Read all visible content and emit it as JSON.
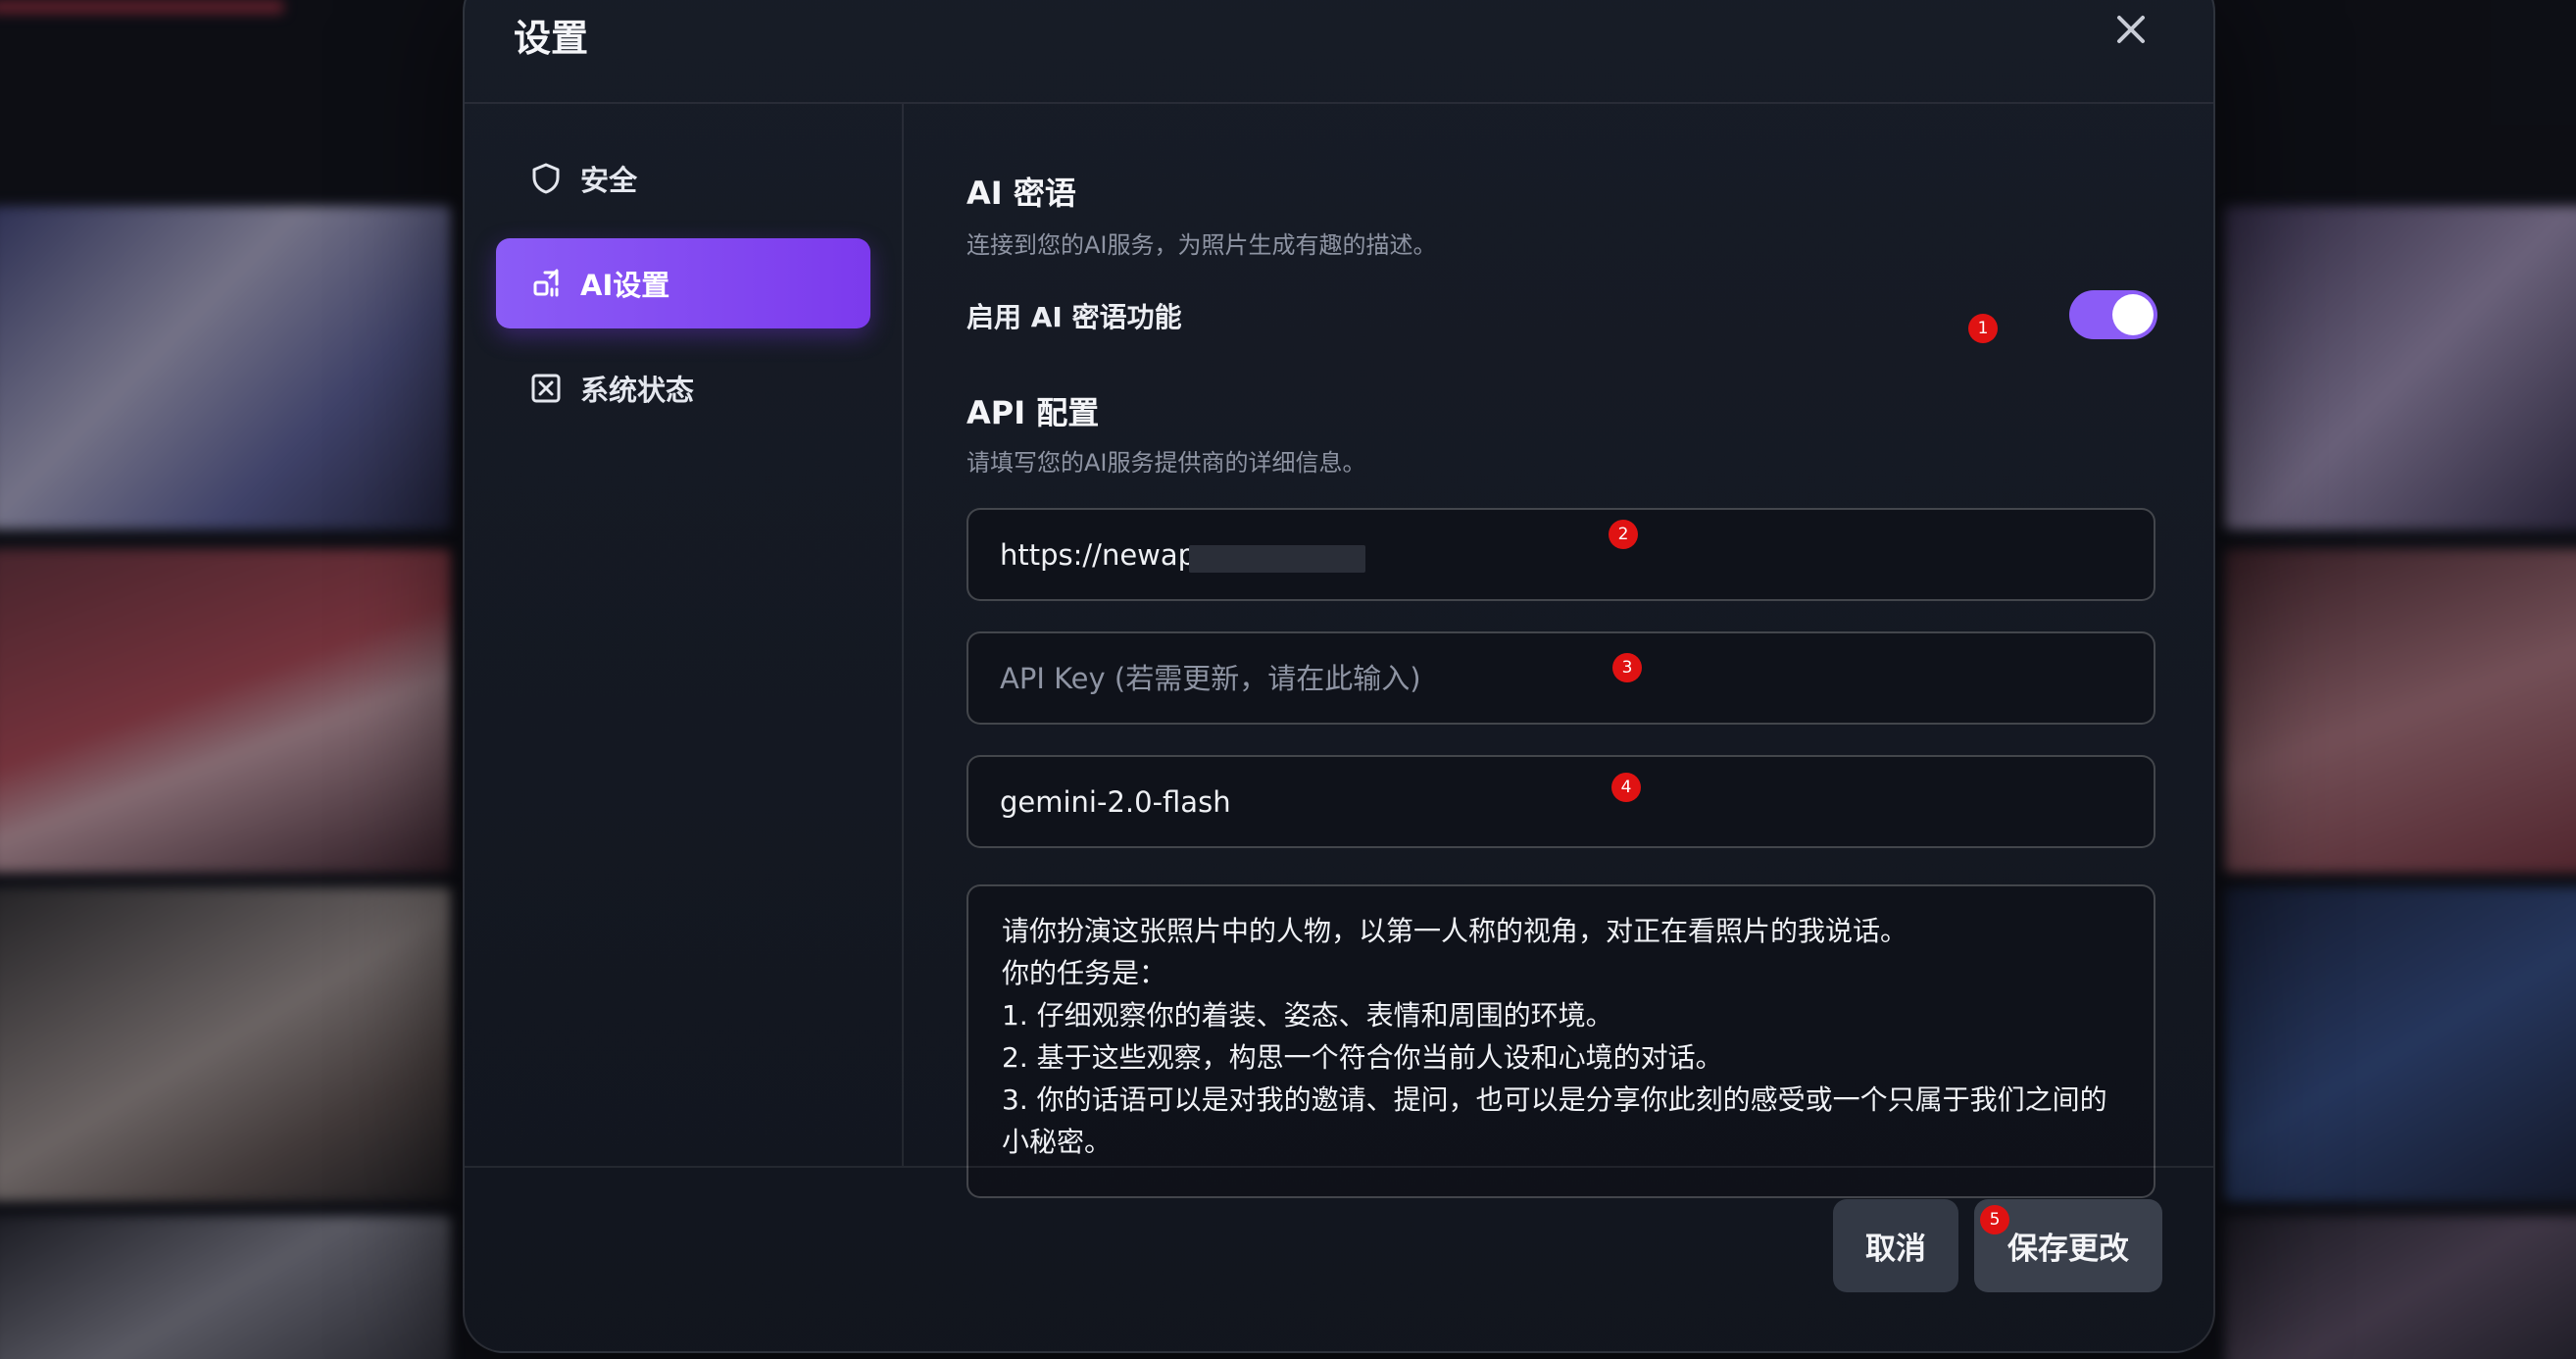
{
  "colors": {
    "accent": "#8b5cf6",
    "marker": "#e01212",
    "panel_bg": "#181d28"
  },
  "modal": {
    "title": "设置",
    "close_icon": "close-icon"
  },
  "sidebar": {
    "items": [
      {
        "label": "安全",
        "icon": "shield-icon",
        "active": false
      },
      {
        "label": "AI设置",
        "icon": "ai-settings-icon",
        "active": true
      },
      {
        "label": "系统状态",
        "icon": "status-box-icon",
        "active": false
      }
    ]
  },
  "ai_section": {
    "title": "AI 密语",
    "description": "连接到您的AI服务，为照片生成有趣的描述。",
    "toggle_label": "启用 AI 密语功能",
    "toggle_on": true
  },
  "api_section": {
    "title": "API 配置",
    "description": "请填写您的AI服务提供商的详细信息。",
    "url_value": "https://newap",
    "api_key_placeholder": "API Key (若需更新，请在此输入)",
    "model_value": "gemini-2.0-flash",
    "prompt_lines": [
      "请你扮演这张照片中的人物，以第一人称的视角，对正在看照片的我说话。",
      "你的任务是：",
      "1.  仔细观察你的着装、姿态、表情和周围的环境。",
      "2.  基于这些观察，构思一个符合你当前人设和心境的对话。",
      "3.  你的话语可以是对我的邀请、提问，也可以是分享你此刻的感受或一个只属于我们之间的小秘密。"
    ]
  },
  "footer": {
    "cancel_label": "取消",
    "save_label": "保存更改"
  },
  "markers": [
    "1",
    "2",
    "3",
    "4",
    "5"
  ]
}
